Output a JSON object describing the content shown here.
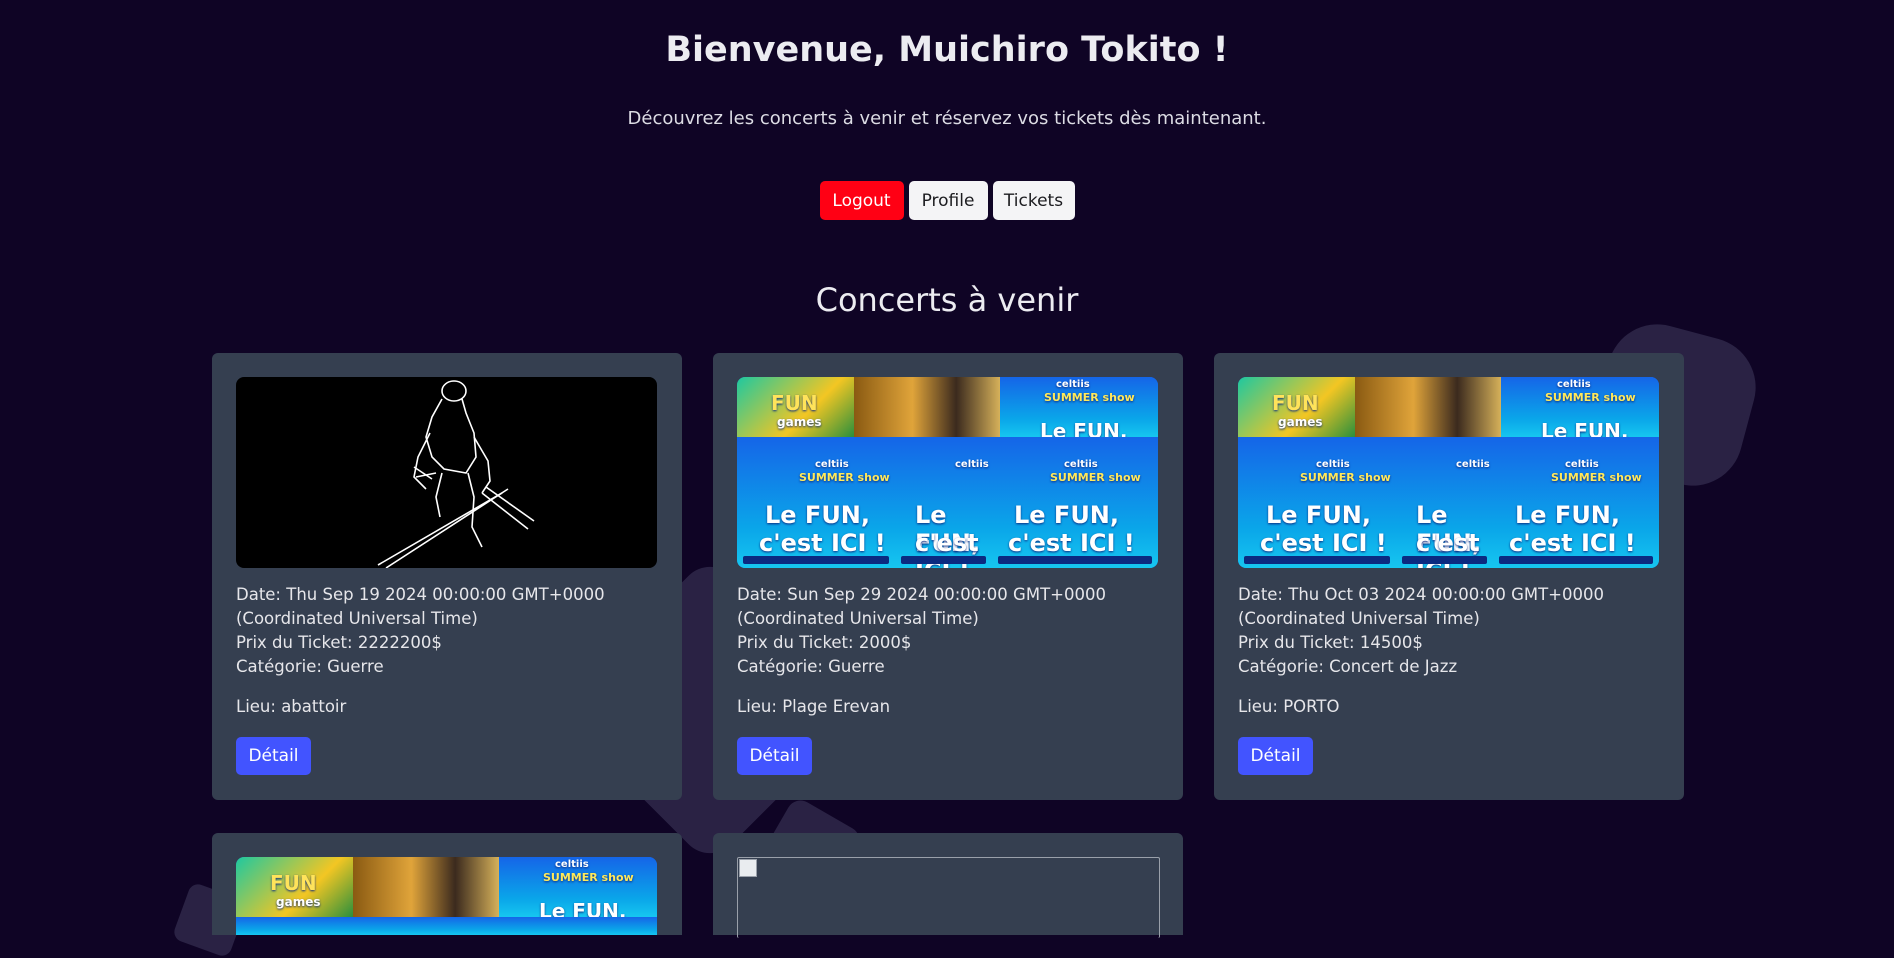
{
  "header": {
    "title": "Bienvenue, Muichiro Tokito !",
    "subtitle": "Découvrez les concerts à venir et réservez vos tickets dès maintenant.",
    "buttons": {
      "logout": "Logout",
      "profile": "Profile",
      "tickets": "Tickets"
    }
  },
  "section_title": "Concerts à venir",
  "colors": {
    "background": "#0f0425",
    "card": "#353f50",
    "logout": "#ff0014",
    "detail": "#4254ff"
  },
  "concerts": [
    {
      "date": "Date: Thu Sep 19 2024 00:00:00 GMT+0000 (Coordinated Universal Time)",
      "price": "Prix du Ticket: 2222200$",
      "category": "Catégorie: Guerre",
      "lieu": "Lieu: abattoir",
      "detail": "Détail",
      "image": "swordsman-sketch"
    },
    {
      "date": "Date: Sun Sep 29 2024 00:00:00 GMT+0000 (Coordinated Universal Time)",
      "price": "Prix du Ticket: 2000$",
      "category": "Catégorie: Guerre",
      "lieu": "Lieu: Plage Erevan",
      "detail": "Détail",
      "image": "summer-show-collage"
    },
    {
      "date": "Date: Thu Oct 03 2024 00:00:00 GMT+0000 (Coordinated Universal Time)",
      "price": "Prix du Ticket: 14500$",
      "category": "Catégorie: Concert de Jazz",
      "lieu": "Lieu: PORTO",
      "detail": "Détail",
      "image": "summer-show-collage"
    }
  ],
  "poster_text": {
    "fun": "FUN",
    "games": "games",
    "celtiis": "celtiis",
    "summer_show": "SUMMER show",
    "le_fun": "Le FUN,",
    "cest_ici": "c'est ICI !"
  }
}
